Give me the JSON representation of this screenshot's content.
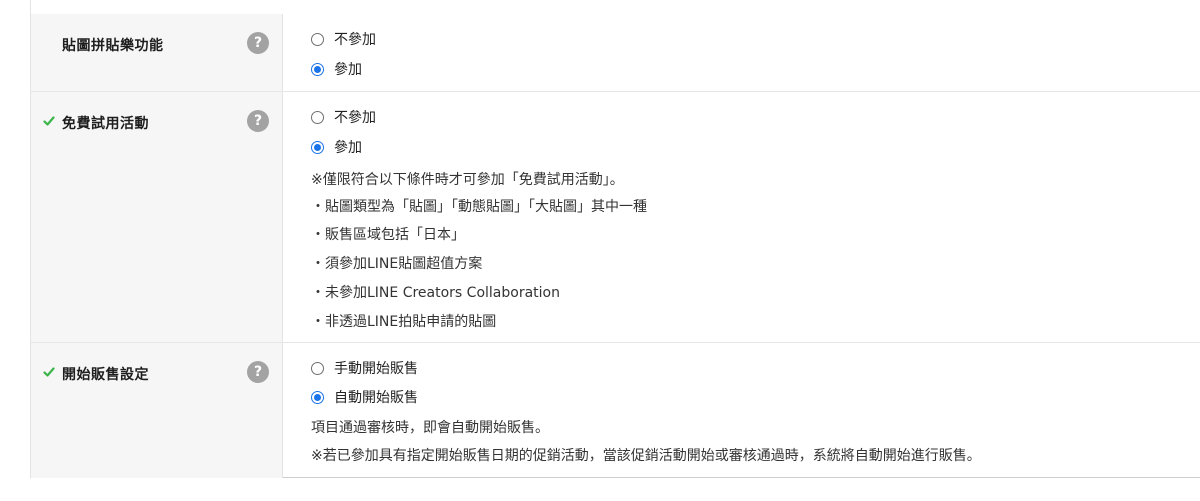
{
  "rows": [
    {
      "label": "貼圖拼貼樂功能",
      "options": [
        "不參加",
        "參加"
      ],
      "selected": 1
    },
    {
      "label": "免費試用活動",
      "options": [
        "不參加",
        "參加"
      ],
      "selected": 1,
      "notes": [
        "※僅限符合以下條件時才可參加「免費試用活動」。",
        "・貼圖類型為「貼圖」「動態貼圖」「大貼圖」其中一種",
        "・販售區域包括「日本」",
        "・須參加LINE貼圖超值方案",
        "・未參加LINE Creators Collaboration",
        "・非透過LINE拍貼申請的貼圖"
      ]
    },
    {
      "label": "開始販售設定",
      "options": [
        "手動開始販售",
        "自動開始販售"
      ],
      "selected": 1,
      "notes": [
        "項目通過審核時，即會自動開始販售。",
        "※若已參加具有指定開始販售日期的促銷活動，當該促銷活動開始或審核通過時，系統將自動開始進行販售。"
      ]
    }
  ],
  "help_symbol": "?",
  "colors": {
    "accent": "#1a73e8",
    "check": "#3bb54a",
    "help_bg": "#a3a3a3"
  }
}
